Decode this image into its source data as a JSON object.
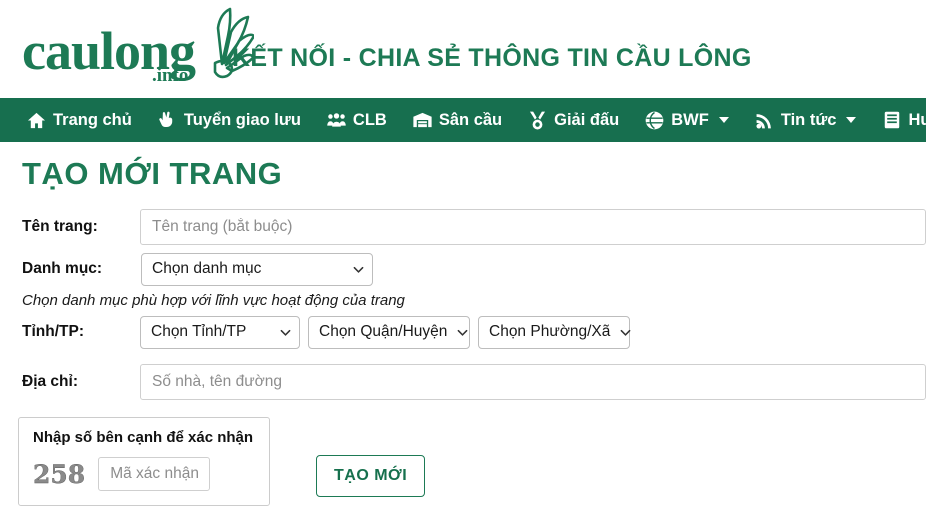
{
  "header": {
    "logo_text": "caulong",
    "logo_suffix": ".info",
    "logo_icon": "shuttlecock-icon",
    "tagline": "KẾT NỐI - CHIA SẺ THÔNG TIN CẦU LÔNG",
    "brand_color": "#1d7a55"
  },
  "nav": {
    "bg_color": "#176f4f",
    "items": [
      {
        "label": "Trang chủ",
        "icon": "home-icon",
        "caret": false
      },
      {
        "label": "Tuyển giao lưu",
        "icon": "hand-peace-icon",
        "caret": false
      },
      {
        "label": "CLB",
        "icon": "users-icon",
        "caret": false
      },
      {
        "label": "Sân cầu",
        "icon": "warehouse-icon",
        "caret": false
      },
      {
        "label": "Giải đấu",
        "icon": "medal-icon",
        "caret": false
      },
      {
        "label": "BWF",
        "icon": "globe-icon",
        "caret": true
      },
      {
        "label": "Tin tức",
        "icon": "rss-icon",
        "caret": true
      },
      {
        "label": "Hướng dẫn",
        "icon": "book-icon",
        "caret": false
      }
    ]
  },
  "page": {
    "title": "TẠO MỚI TRANG",
    "title_color": "#1d7a55"
  },
  "form": {
    "ten_trang": {
      "label": "Tên trang:",
      "placeholder": "Tên trang (bắt buộc)",
      "value": ""
    },
    "danh_muc": {
      "label": "Danh mục:",
      "selected": "Chọn danh mục"
    },
    "hint": "Chọn danh mục phù hợp với lĩnh vực hoạt động của trang",
    "tinh_tp": {
      "label": "Tỉnh/TP:",
      "province_selected": "Chọn Tỉnh/TP",
      "district_selected": "Chọn Quận/Huyện",
      "ward_selected": "Chọn Phường/Xã"
    },
    "dia_chi": {
      "label": "Địa chỉ:",
      "placeholder": "Số nhà, tên đường",
      "value": ""
    }
  },
  "captcha": {
    "legend": "Nhập số bên cạnh để xác nhận",
    "code": "258",
    "input_placeholder": "Mã xác nhận",
    "input_value": ""
  },
  "actions": {
    "submit_label": "TẠO MỚI",
    "submit_color": "#16704d"
  }
}
